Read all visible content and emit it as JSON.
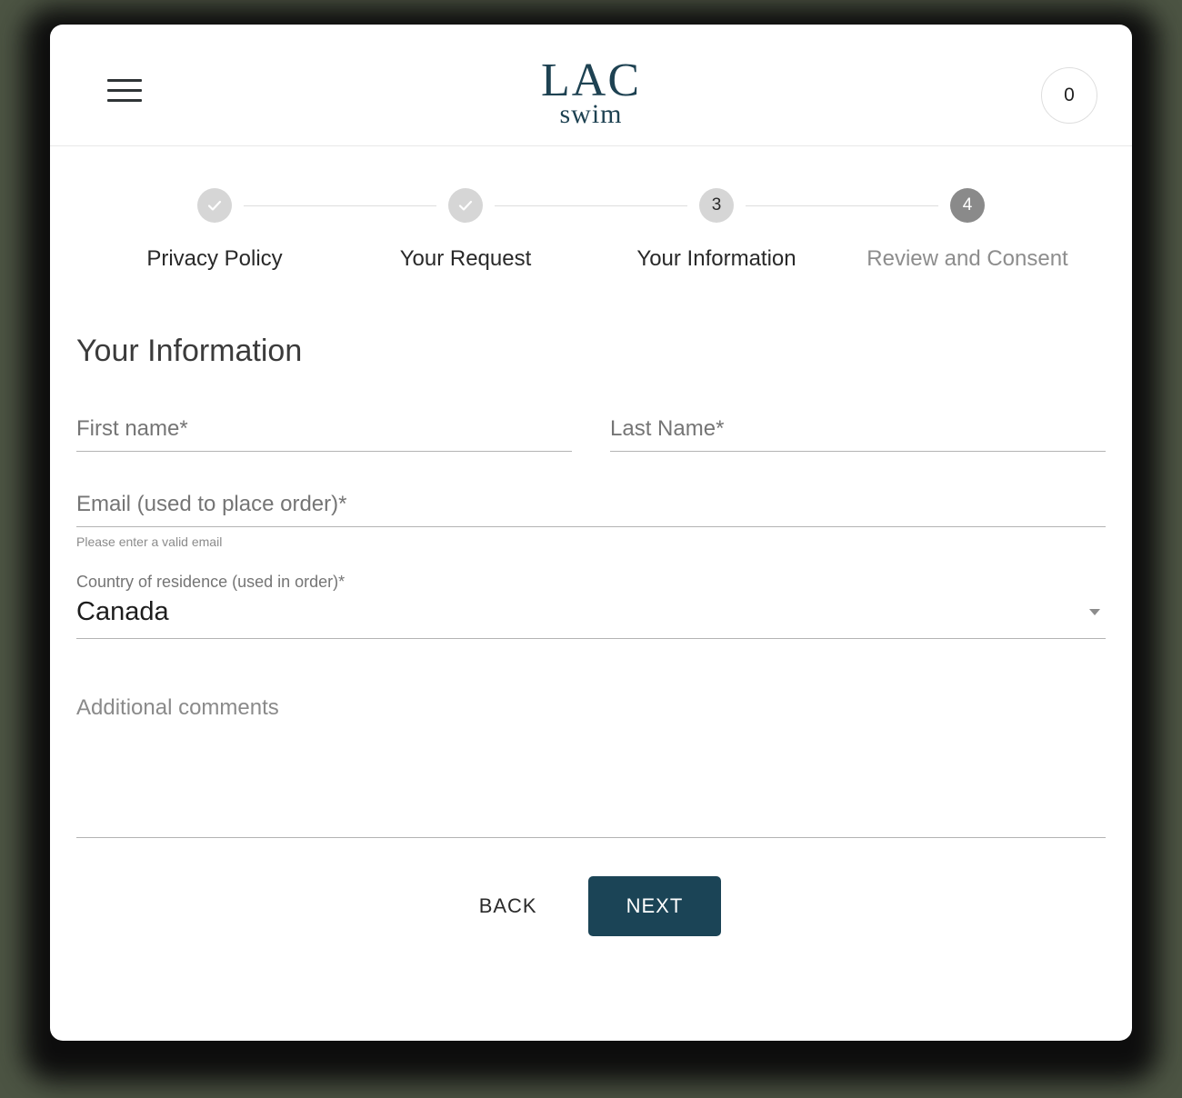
{
  "theme": {
    "page_background": "#4c5443",
    "brand_color": "#1e4252",
    "accent_button": "#1b4456",
    "step_active": "#8a8a8a",
    "step_done": "#d6d6d6"
  },
  "header": {
    "menu_icon": "hamburger-icon",
    "logo_main": "LAC",
    "logo_sub": "swim",
    "cart_count": "0"
  },
  "stepper": {
    "steps": [
      {
        "label": "Privacy Policy",
        "indicator": "check",
        "state": "complete"
      },
      {
        "label": "Your Request",
        "indicator": "check",
        "state": "complete"
      },
      {
        "label": "Your Information",
        "indicator": "3",
        "state": "current"
      },
      {
        "label": "Review and Consent",
        "indicator": "4",
        "state": "upcoming"
      }
    ]
  },
  "form": {
    "title": "Your Information",
    "first_name": {
      "label": "First name",
      "required": "*",
      "value": ""
    },
    "last_name": {
      "label": "Last Name",
      "required": "*",
      "value": ""
    },
    "email": {
      "label": "Email (used to place order)",
      "required": "*",
      "value": "",
      "hint": "Please enter a valid email"
    },
    "country": {
      "label": "Country of residence (used in order)",
      "required": "*",
      "value": "Canada",
      "caret_icon": "chevron-down-icon"
    },
    "comments": {
      "placeholder": "Additional comments",
      "value": ""
    }
  },
  "actions": {
    "back_label": "BACK",
    "next_label": "NEXT"
  }
}
